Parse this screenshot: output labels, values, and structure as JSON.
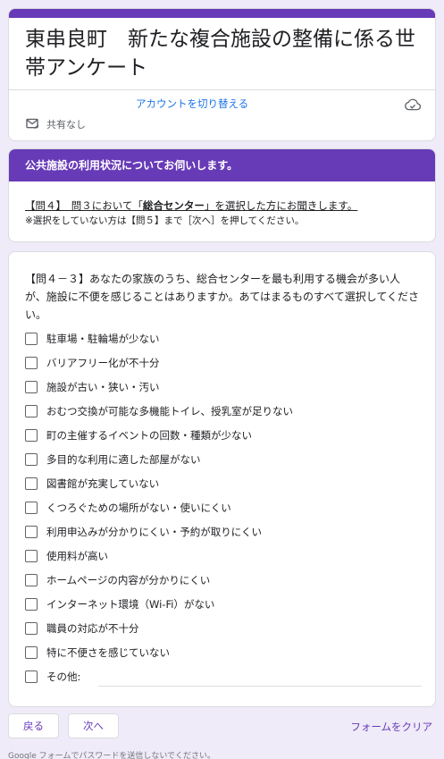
{
  "title": "東串良町　新たな複合施設の整備に係る世帯アンケート",
  "account": {
    "switch_label": "アカウントを切り替える",
    "shared_status": "共有なし"
  },
  "section": {
    "header": "公共施設の利用状況についてお伺いします。",
    "line1_pre": "【問４】　問３において「",
    "line1_bold": "総合センター",
    "line1_post": "」を選択した方にお聞きします。",
    "line2": "※選択をしていない方は【問５】まで［次へ］を押してください。"
  },
  "question": {
    "text": "【問４－３】あなたの家族のうち、総合センターを最も利用する機会が多い人が、施設に不便を感じることはありますか。あてはまるものすべて選択してください。",
    "options": [
      "駐車場・駐輪場が少ない",
      "バリアフリー化が不十分",
      "施設が古い・狭い・汚い",
      "おむつ交換が可能な多機能トイレ、授乳室が足りない",
      "町の主催するイベントの回数・種類が少ない",
      "多目的な利用に適した部屋がない",
      "図書館が充実していない",
      "くつろぐための場所がない・使いにくい",
      "利用申込みが分かりにくい・予約が取りにくい",
      "使用料が高い",
      "ホームページの内容が分かりにくい",
      "インターネット環境（Wi-Fi）がない",
      "職員の対応が不十分",
      "特に不便さを感じていない"
    ],
    "other_label": "その他:"
  },
  "buttons": {
    "back": "戻る",
    "next": "次へ",
    "clear": "フォームをクリア"
  },
  "footer_note": "Google フォームでパスワードを送信しないでください。",
  "colors": {
    "accent": "#673ab7",
    "link": "#1a73e8",
    "background": "#efebf8"
  }
}
